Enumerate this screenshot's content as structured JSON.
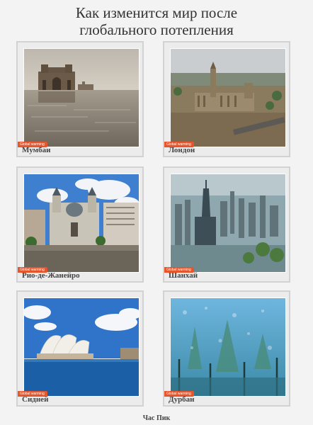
{
  "title_line1": "Как изменится мир после",
  "title_line2": "глобального потепления",
  "tag_text": "Global warming",
  "cities": [
    {
      "name": "Мумбаи",
      "photo": "mumbai-flooded-photo"
    },
    {
      "name": "Лондон",
      "photo": "london-flooded-photo"
    },
    {
      "name": "Рио-де-Жанейро",
      "photo": "rio-flooded-photo"
    },
    {
      "name": "Шанхай",
      "photo": "shanghai-flooded-photo"
    },
    {
      "name": "Сидней",
      "photo": "sydney-flooded-photo"
    },
    {
      "name": "Дурбан",
      "photo": "durban-flooded-photo"
    }
  ],
  "footer": "Час Пик"
}
